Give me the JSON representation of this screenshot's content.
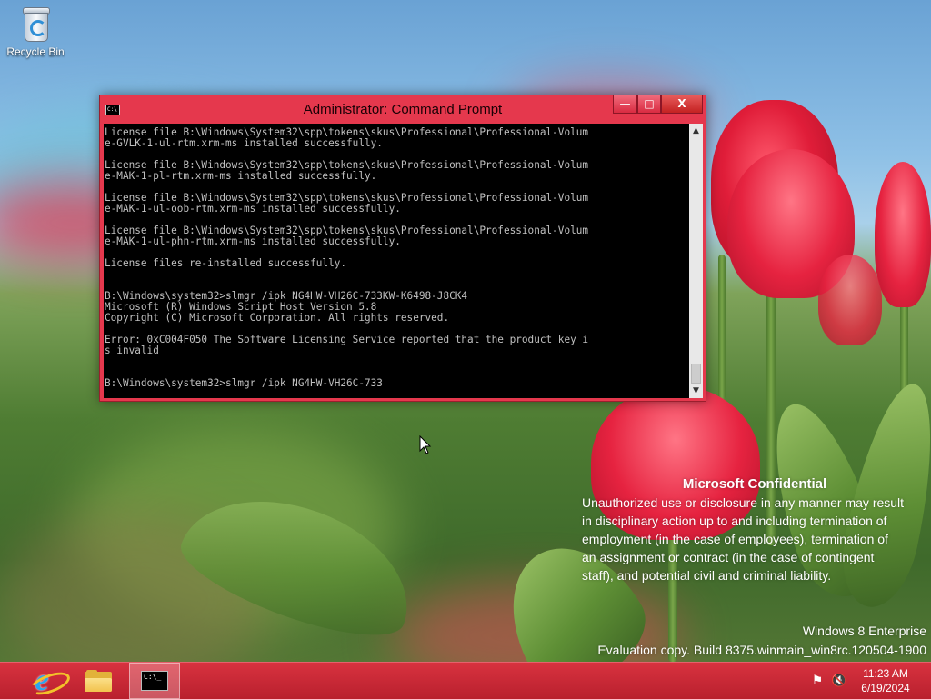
{
  "desktop": {
    "icons": [
      {
        "label": "Recycle Bin",
        "icon": "recycle-bin-icon"
      }
    ]
  },
  "window": {
    "title": "Administrator: Command Prompt",
    "icon": "cmd-icon",
    "controls": {
      "minimize": "—",
      "maximize": "□",
      "close": "X"
    },
    "console_lines": [
      "License file B:\\Windows\\System32\\spp\\tokens\\skus\\Professional\\Professional-Volum",
      "e-GVLK-1-ul-rtm.xrm-ms installed successfully.",
      "",
      "License file B:\\Windows\\System32\\spp\\tokens\\skus\\Professional\\Professional-Volum",
      "e-MAK-1-pl-rtm.xrm-ms installed successfully.",
      "",
      "License file B:\\Windows\\System32\\spp\\tokens\\skus\\Professional\\Professional-Volum",
      "e-MAK-1-ul-oob-rtm.xrm-ms installed successfully.",
      "",
      "License file B:\\Windows\\System32\\spp\\tokens\\skus\\Professional\\Professional-Volum",
      "e-MAK-1-ul-phn-rtm.xrm-ms installed successfully.",
      "",
      "License files re-installed successfully.",
      "",
      "",
      "B:\\Windows\\system32>slmgr /ipk NG4HW-VH26C-733KW-K6498-J8CK4",
      "Microsoft (R) Windows Script Host Version 5.8",
      "Copyright (C) Microsoft Corporation. All rights reserved.",
      "",
      "Error: 0xC004F050 The Software Licensing Service reported that the product key i",
      "s invalid",
      "",
      "",
      "B:\\Windows\\system32>slmgr /ipk NG4HW-VH26C-733"
    ]
  },
  "watermark": {
    "title": "Microsoft Confidential",
    "lines": [
      "Unauthorized use or disclosure in any manner may result",
      "in disciplinary action up to and including termination of",
      "employment (in the case of employees), termination of",
      "an assignment or contract (in the case of contingent",
      "staff), and potential civil and criminal liability."
    ],
    "edition": "Windows 8 Enterprise",
    "build": "Evaluation copy. Build 8375.winmain_win8rc.120504-1900"
  },
  "taskbar": {
    "items": [
      {
        "name": "internet-explorer",
        "icon": "internet-explorer-icon"
      },
      {
        "name": "file-explorer",
        "icon": "folder-icon"
      },
      {
        "name": "command-prompt",
        "icon": "cmd-icon",
        "active": true
      }
    ],
    "tray": {
      "network_icon": "network-flag-icon",
      "sound_icon": "speaker-muted-icon"
    },
    "clock": {
      "time": "11:23 AM",
      "date": "6/19/2024"
    }
  },
  "colors": {
    "taskbar": "#c82533",
    "window_frame": "#e5384d",
    "console_bg": "#000000",
    "console_text": "#c0c0c0"
  }
}
